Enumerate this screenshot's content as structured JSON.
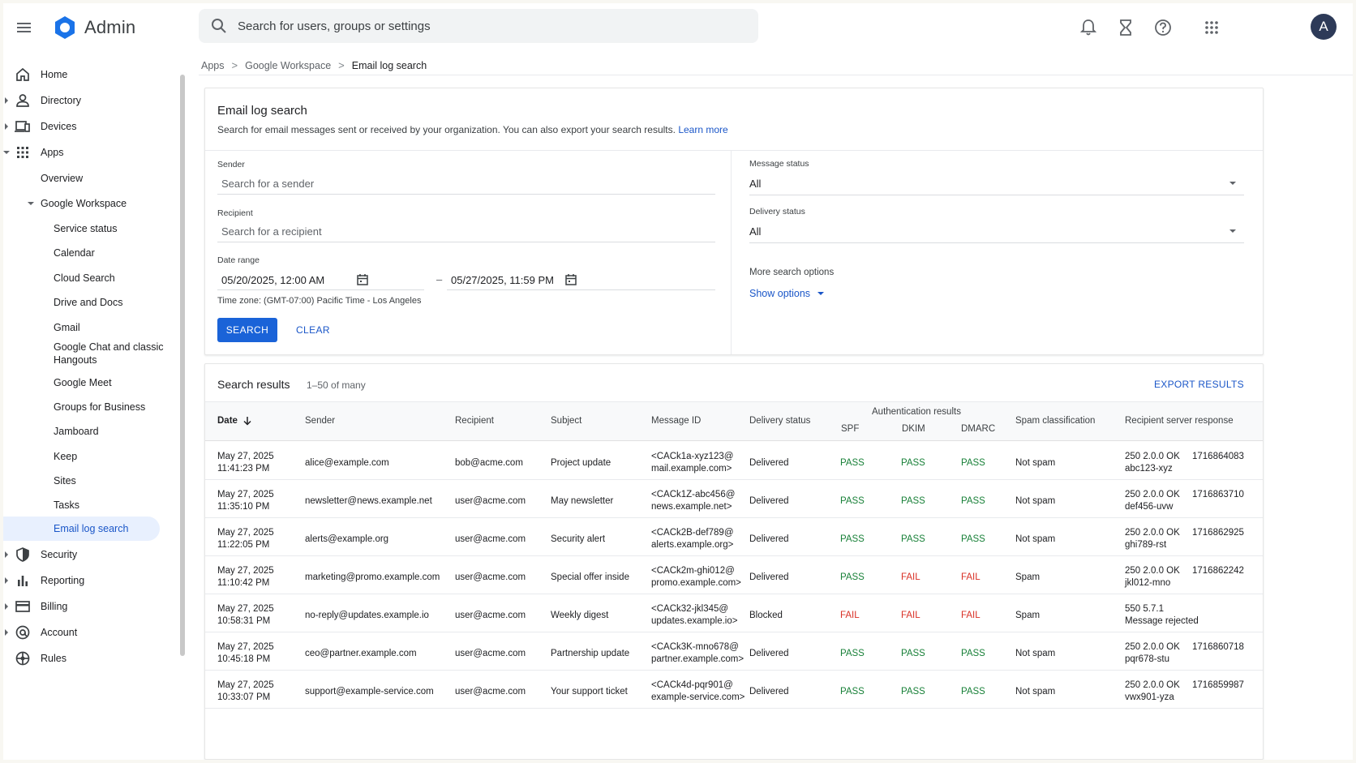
{
  "app": {
    "title": "Admin",
    "avatar_letter": "A",
    "search_placeholder": "Search for users, groups or settings"
  },
  "sidebar": {
    "items": [
      {
        "label": "Home",
        "icon": "home-icon"
      },
      {
        "label": "Directory",
        "icon": "person-icon"
      },
      {
        "label": "Devices",
        "icon": "devices-icon"
      },
      {
        "label": "Apps",
        "icon": "apps-grid-icon"
      },
      {
        "label": "Overview"
      },
      {
        "label": "Google Workspace"
      },
      {
        "label": "Service status"
      },
      {
        "label": "Calendar"
      },
      {
        "label": "Cloud Search"
      },
      {
        "label": "Drive and Docs"
      },
      {
        "label": "Gmail"
      },
      {
        "label": "Google Chat and classic Hangouts"
      },
      {
        "label": "Google Meet"
      },
      {
        "label": "Groups for Business"
      },
      {
        "label": "Jamboard"
      },
      {
        "label": "Keep"
      },
      {
        "label": "Sites"
      },
      {
        "label": "Tasks"
      },
      {
        "label": "Email log search"
      },
      {
        "label": "Security",
        "icon": "shield-icon"
      },
      {
        "label": "Reporting",
        "icon": "bar-chart-icon"
      },
      {
        "label": "Billing",
        "icon": "credit-card-icon"
      },
      {
        "label": "Account",
        "icon": "at-sign-icon"
      },
      {
        "label": "Rules",
        "icon": "rules-icon"
      }
    ]
  },
  "breadcrumb": {
    "items": [
      "Apps",
      "Google Workspace",
      "Email log search"
    ],
    "separator": ">"
  },
  "search_panel": {
    "title": "Email log search",
    "description": "Search for email messages sent or received by your organization. You can also export your search results.",
    "learn_more": "Learn more",
    "sender_label": "Sender",
    "sender_placeholder": "Search for a sender",
    "recipient_label": "Recipient",
    "recipient_placeholder": "Search for a recipient",
    "date_range_label": "Date range",
    "date_from": "05/20/2025, 12:00 AM",
    "date_to": "05/27/2025, 11:59 PM",
    "date_sep": "–",
    "timezone": "Time zone: (GMT-07:00) Pacific Time - Los Angeles",
    "message_status_label": "Message status",
    "message_status_value": "All",
    "delivery_status_label": "Delivery status",
    "delivery_status_value": "All",
    "more_options_label": "More search options",
    "show_options": "Show options",
    "search_button": "SEARCH",
    "clear_button": "CLEAR"
  },
  "results": {
    "title": "Search results",
    "count": "1–50 of many",
    "export": "EXPORT RESULTS",
    "headers": {
      "date": "Date",
      "sender": "Sender",
      "recipient": "Recipient",
      "subject": "Subject",
      "message_id": "Message ID",
      "delivery_status": "Delivery status",
      "auth": "Authentication results",
      "spf": "SPF",
      "dkim": "DKIM",
      "dmarc": "DMARC",
      "spam": "Spam classification",
      "response": "Recipient server response"
    },
    "rows": [
      {
        "date1": "May 27, 2025",
        "date2": "11:41:23 PM",
        "sender": "alice@example.com",
        "recipient": "bob@acme.com",
        "subject": "Project update",
        "mid1": "<CACk1a-xyz123@",
        "mid2": "mail.example.com>",
        "delivery": "Delivered",
        "spf": "PASS",
        "dkim": "PASS",
        "dmarc": "PASS",
        "spam": "Not spam",
        "resp1": "250 2.0.0 OK",
        "resp_num": "1716864083",
        "resp2": "abc123-xyz"
      },
      {
        "date1": "May 27, 2025",
        "date2": "11:35:10 PM",
        "sender": "newsletter@news.example.net",
        "recipient": "user@acme.com",
        "subject": "May newsletter",
        "mid1": "<CACk1Z-abc456@",
        "mid2": "news.example.net>",
        "delivery": "Delivered",
        "spf": "PASS",
        "dkim": "PASS",
        "dmarc": "PASS",
        "spam": "Not spam",
        "resp1": "250 2.0.0 OK",
        "resp_num": "1716863710",
        "resp2": "def456-uvw"
      },
      {
        "date1": "May 27, 2025",
        "date2": "11:22:05 PM",
        "sender": "alerts@example.org",
        "recipient": "user@acme.com",
        "subject": "Security alert",
        "mid1": "<CACk2B-def789@",
        "mid2": "alerts.example.org>",
        "delivery": "Delivered",
        "spf": "PASS",
        "dkim": "PASS",
        "dmarc": "PASS",
        "spam": "Not spam",
        "resp1": "250 2.0.0 OK",
        "resp_num": "1716862925",
        "resp2": "ghi789-rst"
      },
      {
        "date1": "May 27, 2025",
        "date2": "11:10:42 PM",
        "sender": "marketing@promo.example.com",
        "recipient": "user@acme.com",
        "subject": "Special offer inside",
        "mid1": "<CACk2m-ghi012@",
        "mid2": "promo.example.com>",
        "delivery": "Delivered",
        "spf": "PASS",
        "dkim": "FAIL",
        "dmarc": "FAIL",
        "spam": "Spam",
        "resp1": "250 2.0.0 OK",
        "resp_num": "1716862242",
        "resp2": "jkl012-mno"
      },
      {
        "date1": "May 27, 2025",
        "date2": "10:58:31 PM",
        "sender": "no-reply@updates.example.io",
        "recipient": "user@acme.com",
        "subject": "Weekly digest",
        "mid1": "<CACk32-jkl345@",
        "mid2": "updates.example.io>",
        "delivery": "Blocked",
        "spf": "FAIL",
        "dkim": "FAIL",
        "dmarc": "FAIL",
        "spam": "Spam",
        "resp1": "550 5.7.1",
        "resp_num": "",
        "resp2": "Message rejected"
      },
      {
        "date1": "May 27, 2025",
        "date2": "10:45:18 PM",
        "sender": "ceo@partner.example.com",
        "recipient": "user@acme.com",
        "subject": "Partnership update",
        "mid1": "<CACk3K-mno678@",
        "mid2": "partner.example.com>",
        "delivery": "Delivered",
        "spf": "PASS",
        "dkim": "PASS",
        "dmarc": "PASS",
        "spam": "Not spam",
        "resp1": "250 2.0.0 OK",
        "resp_num": "1716860718",
        "resp2": "pqr678-stu"
      },
      {
        "date1": "May 27, 2025",
        "date2": "10:33:07 PM",
        "sender": "support@example-service.com",
        "recipient": "user@acme.com",
        "subject": "Your support ticket",
        "mid1": "<CACk4d-pqr901@",
        "mid2": "example-service.com>",
        "delivery": "Delivered",
        "spf": "PASS",
        "dkim": "PASS",
        "dmarc": "PASS",
        "spam": "Not spam",
        "resp1": "250 2.0.0 OK",
        "resp_num": "1716859987",
        "resp2": "vwx901-yza"
      }
    ]
  },
  "colors": {
    "accent": "#1a63d8",
    "link": "#1a56c8",
    "pass": "#188038",
    "fail": "#d93025",
    "active_nav_bg": "#e8f0fe"
  }
}
